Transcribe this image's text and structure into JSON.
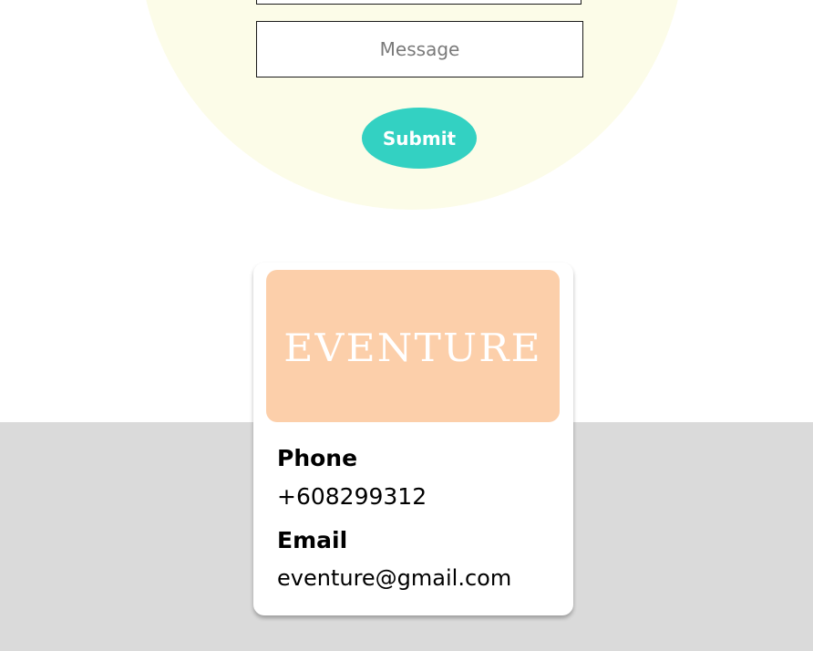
{
  "form": {
    "message_placeholder": "Message",
    "submit_label": "Submit"
  },
  "contact_card": {
    "logo_text": "EVENTURE",
    "phone_label": "Phone",
    "phone_value": "+608299312",
    "email_label": "Email",
    "email_value": "eventure@gmail.com"
  },
  "colors": {
    "page_background": "#ffffff",
    "cream_circle": "#fcfce8",
    "submit_button": "#33d1c2",
    "logo_background": "#fccfaa",
    "footer_band": "#dadada"
  }
}
